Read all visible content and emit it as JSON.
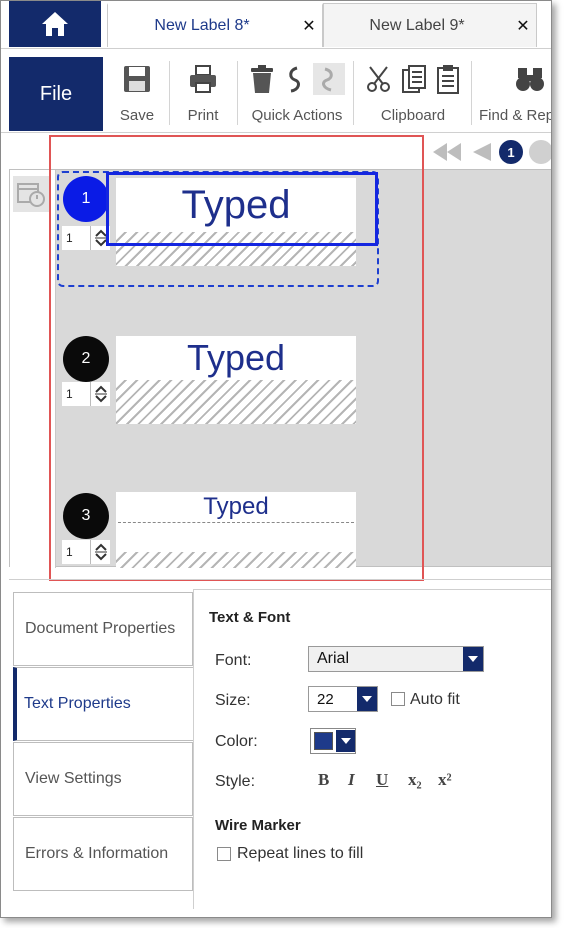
{
  "tabs": [
    {
      "label": "New Label 8*",
      "active": true
    },
    {
      "label": "New Label 9*",
      "active": false
    }
  ],
  "ribbon": {
    "file_label": "File",
    "groups": [
      {
        "label": "Save"
      },
      {
        "label": "Print"
      },
      {
        "label": "Quick Actions"
      },
      {
        "label": "Clipboard"
      },
      {
        "label": "Find & Rep"
      }
    ]
  },
  "pager": {
    "current": "1"
  },
  "labels": [
    {
      "marker": "1",
      "qty": "1",
      "text": "Typed",
      "selected": true
    },
    {
      "marker": "2",
      "qty": "1",
      "text": "Typed",
      "selected": false
    },
    {
      "marker": "3",
      "qty": "1",
      "text": "Typed",
      "selected": false
    }
  ],
  "side_tabs": [
    {
      "label": "Document Properties",
      "active": false
    },
    {
      "label": "Text Properties",
      "active": true
    },
    {
      "label": "View Settings",
      "active": false
    },
    {
      "label": "Errors & Information",
      "active": false
    }
  ],
  "text_props": {
    "section_title": "Text & Font",
    "font_label": "Font:",
    "font_value": "Arial",
    "size_label": "Size:",
    "size_value": "22",
    "autofit_label": "Auto fit",
    "autofit_checked": false,
    "color_label": "Color:",
    "color_value": "#1e3a8a",
    "style_label": "Style:",
    "style_buttons": [
      "B",
      "I",
      "U",
      "x₂",
      "x²"
    ],
    "wire_title": "Wire Marker",
    "repeat_label": "Repeat lines to fill",
    "repeat_checked": false
  },
  "colors": {
    "brand_navy": "#132a6b",
    "label_text": "#1e2f8c",
    "selection_blue": "#1426e0",
    "highlight_red": "#e05555"
  }
}
